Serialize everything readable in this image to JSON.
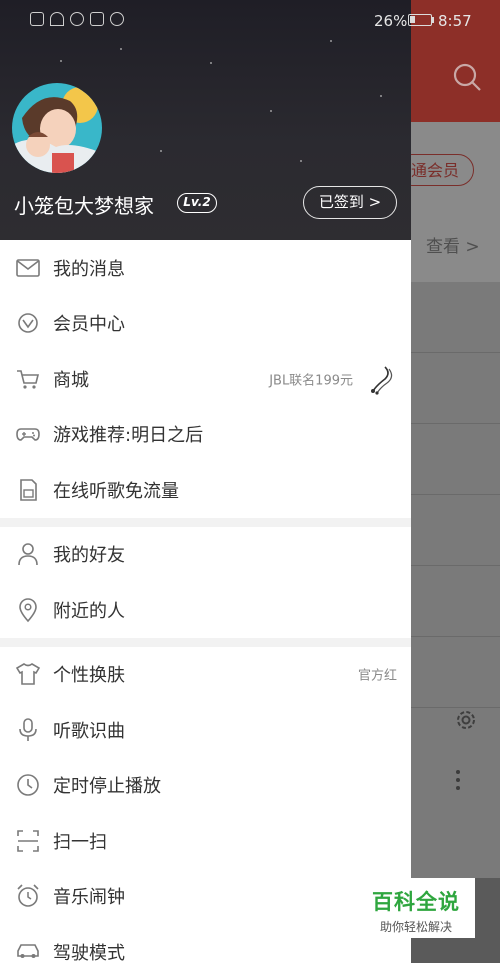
{
  "status_bar": {
    "battery": "26%",
    "time": "8:57"
  },
  "background_app": {
    "vip_button": "通会员",
    "view_link": "查看 >"
  },
  "profile": {
    "username": "小笼包大梦想家",
    "level": "Lv.2",
    "checkin_button": "已签到 >"
  },
  "menu": {
    "group1": [
      {
        "label": "我的消息",
        "icon": "mail-icon"
      },
      {
        "label": "会员中心",
        "icon": "vip-icon"
      },
      {
        "label": "商城",
        "icon": "cart-icon",
        "value": "JBL联名199元"
      },
      {
        "label": "游戏推荐:明日之后",
        "icon": "gamepad-icon"
      },
      {
        "label": "在线听歌免流量",
        "icon": "sim-card-icon"
      }
    ],
    "group2": [
      {
        "label": "我的好友",
        "icon": "person-icon"
      },
      {
        "label": "附近的人",
        "icon": "location-pin-icon"
      }
    ],
    "group3": [
      {
        "label": "个性换肤",
        "icon": "tshirt-icon",
        "value": "官方红"
      },
      {
        "label": "听歌识曲",
        "icon": "microphone-icon"
      },
      {
        "label": "定时停止播放",
        "icon": "clock-icon"
      },
      {
        "label": "扫一扫",
        "icon": "scan-icon"
      },
      {
        "label": "音乐闹钟",
        "icon": "alarm-clock-icon"
      },
      {
        "label": "驾驶模式",
        "icon": "car-icon"
      }
    ]
  },
  "watermark": {
    "title": "百科全说",
    "subtitle": "助你轻松解决"
  }
}
